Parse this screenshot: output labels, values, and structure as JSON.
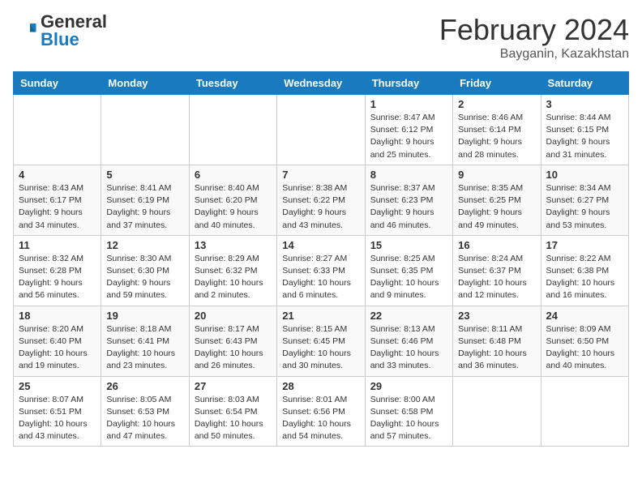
{
  "header": {
    "logo": {
      "general": "General",
      "blue": "Blue"
    },
    "title": "February 2024",
    "subtitle": "Bayganin, Kazakhstan"
  },
  "weekdays": [
    "Sunday",
    "Monday",
    "Tuesday",
    "Wednesday",
    "Thursday",
    "Friday",
    "Saturday"
  ],
  "weeks": [
    [
      {
        "day": null,
        "info": null
      },
      {
        "day": null,
        "info": null
      },
      {
        "day": null,
        "info": null
      },
      {
        "day": null,
        "info": null
      },
      {
        "day": "1",
        "info": "Sunrise: 8:47 AM\nSunset: 6:12 PM\nDaylight: 9 hours and 25 minutes."
      },
      {
        "day": "2",
        "info": "Sunrise: 8:46 AM\nSunset: 6:14 PM\nDaylight: 9 hours and 28 minutes."
      },
      {
        "day": "3",
        "info": "Sunrise: 8:44 AM\nSunset: 6:15 PM\nDaylight: 9 hours and 31 minutes."
      }
    ],
    [
      {
        "day": "4",
        "info": "Sunrise: 8:43 AM\nSunset: 6:17 PM\nDaylight: 9 hours and 34 minutes."
      },
      {
        "day": "5",
        "info": "Sunrise: 8:41 AM\nSunset: 6:19 PM\nDaylight: 9 hours and 37 minutes."
      },
      {
        "day": "6",
        "info": "Sunrise: 8:40 AM\nSunset: 6:20 PM\nDaylight: 9 hours and 40 minutes."
      },
      {
        "day": "7",
        "info": "Sunrise: 8:38 AM\nSunset: 6:22 PM\nDaylight: 9 hours and 43 minutes."
      },
      {
        "day": "8",
        "info": "Sunrise: 8:37 AM\nSunset: 6:23 PM\nDaylight: 9 hours and 46 minutes."
      },
      {
        "day": "9",
        "info": "Sunrise: 8:35 AM\nSunset: 6:25 PM\nDaylight: 9 hours and 49 minutes."
      },
      {
        "day": "10",
        "info": "Sunrise: 8:34 AM\nSunset: 6:27 PM\nDaylight: 9 hours and 53 minutes."
      }
    ],
    [
      {
        "day": "11",
        "info": "Sunrise: 8:32 AM\nSunset: 6:28 PM\nDaylight: 9 hours and 56 minutes."
      },
      {
        "day": "12",
        "info": "Sunrise: 8:30 AM\nSunset: 6:30 PM\nDaylight: 9 hours and 59 minutes."
      },
      {
        "day": "13",
        "info": "Sunrise: 8:29 AM\nSunset: 6:32 PM\nDaylight: 10 hours and 2 minutes."
      },
      {
        "day": "14",
        "info": "Sunrise: 8:27 AM\nSunset: 6:33 PM\nDaylight: 10 hours and 6 minutes."
      },
      {
        "day": "15",
        "info": "Sunrise: 8:25 AM\nSunset: 6:35 PM\nDaylight: 10 hours and 9 minutes."
      },
      {
        "day": "16",
        "info": "Sunrise: 8:24 AM\nSunset: 6:37 PM\nDaylight: 10 hours and 12 minutes."
      },
      {
        "day": "17",
        "info": "Sunrise: 8:22 AM\nSunset: 6:38 PM\nDaylight: 10 hours and 16 minutes."
      }
    ],
    [
      {
        "day": "18",
        "info": "Sunrise: 8:20 AM\nSunset: 6:40 PM\nDaylight: 10 hours and 19 minutes."
      },
      {
        "day": "19",
        "info": "Sunrise: 8:18 AM\nSunset: 6:41 PM\nDaylight: 10 hours and 23 minutes."
      },
      {
        "day": "20",
        "info": "Sunrise: 8:17 AM\nSunset: 6:43 PM\nDaylight: 10 hours and 26 minutes."
      },
      {
        "day": "21",
        "info": "Sunrise: 8:15 AM\nSunset: 6:45 PM\nDaylight: 10 hours and 30 minutes."
      },
      {
        "day": "22",
        "info": "Sunrise: 8:13 AM\nSunset: 6:46 PM\nDaylight: 10 hours and 33 minutes."
      },
      {
        "day": "23",
        "info": "Sunrise: 8:11 AM\nSunset: 6:48 PM\nDaylight: 10 hours and 36 minutes."
      },
      {
        "day": "24",
        "info": "Sunrise: 8:09 AM\nSunset: 6:50 PM\nDaylight: 10 hours and 40 minutes."
      }
    ],
    [
      {
        "day": "25",
        "info": "Sunrise: 8:07 AM\nSunset: 6:51 PM\nDaylight: 10 hours and 43 minutes."
      },
      {
        "day": "26",
        "info": "Sunrise: 8:05 AM\nSunset: 6:53 PM\nDaylight: 10 hours and 47 minutes."
      },
      {
        "day": "27",
        "info": "Sunrise: 8:03 AM\nSunset: 6:54 PM\nDaylight: 10 hours and 50 minutes."
      },
      {
        "day": "28",
        "info": "Sunrise: 8:01 AM\nSunset: 6:56 PM\nDaylight: 10 hours and 54 minutes."
      },
      {
        "day": "29",
        "info": "Sunrise: 8:00 AM\nSunset: 6:58 PM\nDaylight: 10 hours and 57 minutes."
      },
      {
        "day": null,
        "info": null
      },
      {
        "day": null,
        "info": null
      }
    ]
  ]
}
